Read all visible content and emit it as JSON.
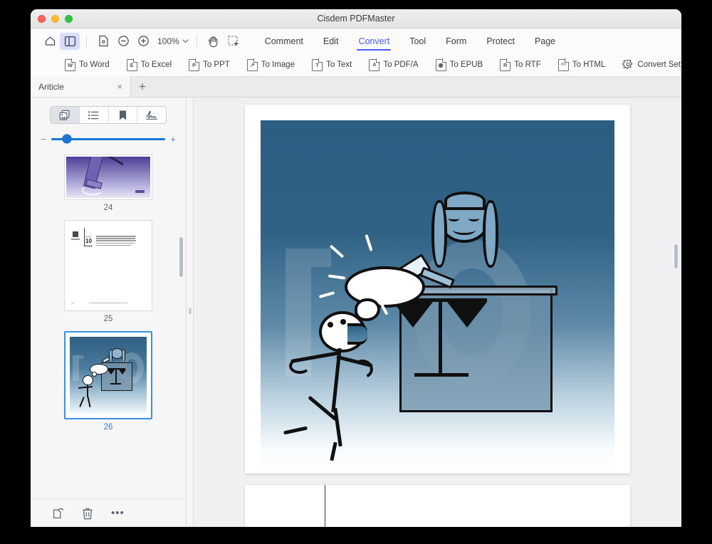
{
  "window": {
    "title": "Cisdem PDFMaster",
    "traffic_lights": [
      "close",
      "minimize",
      "maximize"
    ]
  },
  "toolbar": {
    "icons": [
      {
        "name": "home-icon",
        "label": "Home",
        "active": false
      },
      {
        "name": "sidebar-toggle-icon",
        "label": "Toggle Sidebar",
        "active": true
      },
      {
        "name": "page-fit-icon",
        "label": "Fit Page",
        "active": false
      },
      {
        "name": "zoom-out-icon",
        "label": "Zoom Out",
        "active": false
      },
      {
        "name": "zoom-in-icon",
        "label": "Zoom In",
        "active": false
      },
      {
        "name": "hand-tool-icon",
        "label": "Hand Tool",
        "active": false
      },
      {
        "name": "select-area-icon",
        "label": "Select Area",
        "active": false
      }
    ],
    "zoom_level": "100%",
    "zoom_caret": "⌄"
  },
  "menu_tabs": [
    {
      "label": "Comment",
      "selected": false
    },
    {
      "label": "Edit",
      "selected": false
    },
    {
      "label": "Convert",
      "selected": true
    },
    {
      "label": "Tool",
      "selected": false
    },
    {
      "label": "Form",
      "selected": false
    },
    {
      "label": "Protect",
      "selected": false
    },
    {
      "label": "Page",
      "selected": false
    }
  ],
  "convert_bar": {
    "items": [
      {
        "label": "To Word",
        "glyph": "W",
        "icon": "word-doc-icon"
      },
      {
        "label": "To Excel",
        "glyph": "E",
        "icon": "excel-doc-icon"
      },
      {
        "label": "To PPT",
        "glyph": "P",
        "icon": "ppt-doc-icon"
      },
      {
        "label": "To Image",
        "glyph": "↗",
        "icon": "image-doc-icon"
      },
      {
        "label": "To Text",
        "glyph": "T",
        "icon": "text-doc-icon"
      },
      {
        "label": "To PDF/A",
        "glyph": "A",
        "icon": "pdfa-doc-icon"
      },
      {
        "label": "To EPUB",
        "glyph": "◉",
        "icon": "epub-doc-icon"
      },
      {
        "label": "To RTF",
        "glyph": "R",
        "icon": "rtf-doc-icon"
      },
      {
        "label": "To HTML",
        "glyph": "<>",
        "icon": "html-doc-icon"
      },
      {
        "label": "Convert Settings",
        "glyph": "",
        "icon": "gear-icon"
      }
    ]
  },
  "document_tabs": {
    "tabs": [
      {
        "title": "Ariticle",
        "close_glyph": "×"
      }
    ],
    "new_tab_glyph": "+"
  },
  "sidebar": {
    "panel_tabs": [
      {
        "name": "thumbnails-tab",
        "active": true
      },
      {
        "name": "outline-tab",
        "active": false
      },
      {
        "name": "bookmarks-tab",
        "active": false
      },
      {
        "name": "signature-tab",
        "active": false
      }
    ],
    "zoom_slider": {
      "minus": "−",
      "plus": "+",
      "value_percent": 14
    },
    "thumbnails": [
      {
        "page": "24",
        "selected": false,
        "kind": "gavel-purple"
      },
      {
        "page": "25",
        "selected": false,
        "kind": "text-page"
      },
      {
        "page": "26",
        "selected": true,
        "kind": "judge-blue"
      }
    ],
    "footer_actions": [
      {
        "name": "rotate-page-button",
        "glyph": "rotate"
      },
      {
        "name": "delete-page-button",
        "glyph": "trash"
      },
      {
        "name": "more-options-button",
        "glyph": "•••"
      }
    ]
  },
  "divider": {
    "grip_glyph": "‖"
  },
  "viewer": {
    "current_page_label": "26",
    "illustration": {
      "alt": "Stick figure shouting at a judge behind a bench with scales of justice and a gavel",
      "background_watermark": "10",
      "bg_top_color": "#2e5f82",
      "bg_bottom_color": "#ffffff"
    }
  },
  "page_text": {
    "article_label": "Article",
    "article_number": "10",
    "body": "Everyone is entitled to full equality to a fair and public hearing by an independent and impartial tribunal, in the determination of his rights and obligations and of any criminal charge against him.",
    "footer": "Universal Declaration of Human Rights"
  }
}
